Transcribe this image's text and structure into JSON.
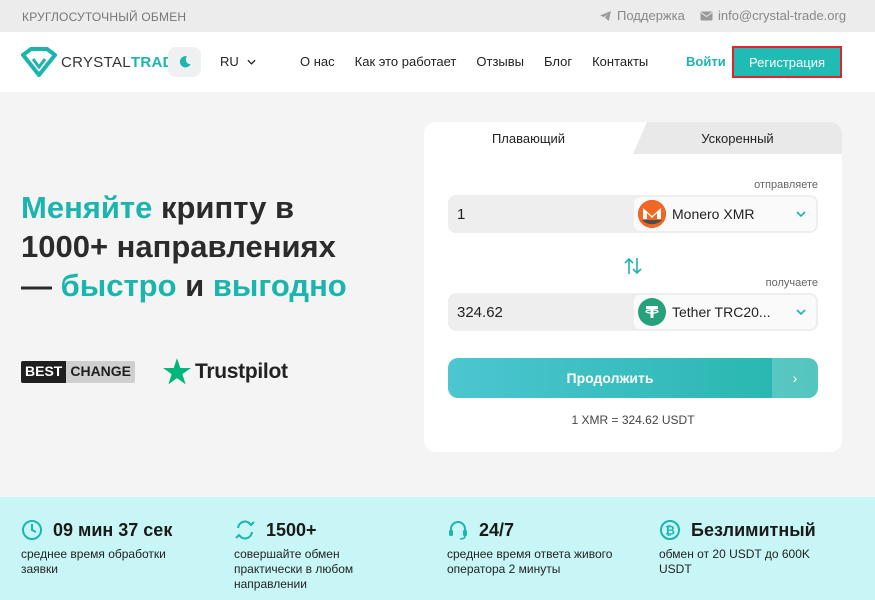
{
  "topbar": {
    "tagline": "КРУГЛОСУТОЧНЫЙ ОБМЕН",
    "support": "Поддержка",
    "email": "info@crystal-trade.org"
  },
  "header": {
    "logo_part1": "CRYSTAL",
    "logo_part2": "TRADE",
    "language": "RU",
    "nav": [
      "О нас",
      "Как это работает",
      "Отзывы",
      "Блог",
      "Контакты"
    ],
    "login": "Войти",
    "register": "Регистрация"
  },
  "hero": {
    "w1": "Меняйте",
    "w2": " крипту в",
    "line2": "1000+ направлениях",
    "w3": "— ",
    "w4": "быстро",
    "w5": " и ",
    "w6": "выгодно",
    "partner1a": "BEST",
    "partner1b": "CHANGE",
    "partner2": "Trustpilot"
  },
  "exchange": {
    "tab_floating": "Плавающий",
    "tab_fast": "Ускоренный",
    "send_label": "отправляете",
    "send_amount": "1",
    "send_currency": "Monero XMR",
    "receive_label": "получаете",
    "receive_amount": "324.62",
    "receive_currency": "Tether TRC20...",
    "continue": "Продолжить",
    "arrow": "›",
    "rate": "1 XMR = 324.62 USDT"
  },
  "stats": [
    {
      "title": "09 мин 37 сек",
      "desc": "среднее время обработки заявки",
      "icon": "clock-icon"
    },
    {
      "title": "1500+",
      "desc": "совершайте обмен практически в любом направлении",
      "icon": "exchange-icon"
    },
    {
      "title": "24/7",
      "desc": "среднее время ответа живого оператора 2 минуты",
      "icon": "headset-icon"
    },
    {
      "title": "Безлимитный",
      "desc": "обмен от 20 USDT до 600K USDT",
      "icon": "bitcoin-icon"
    }
  ],
  "colors": {
    "accent": "#1bb5ad",
    "register_bg": "#20bcb3",
    "stats_bg": "#c8f6f7",
    "monero": "#f26822",
    "tether": "#26a17b"
  }
}
